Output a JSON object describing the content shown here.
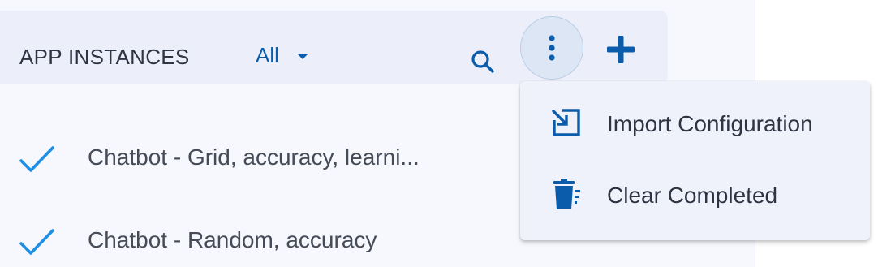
{
  "header": {
    "title": "APP INSTANCES",
    "filter_value": "All",
    "icons": {
      "search": "search-icon",
      "more": "more-vert-icon",
      "add": "add-icon"
    }
  },
  "instances": [
    {
      "label": "Chatbot - Grid, accuracy, learni...",
      "status": "completed",
      "icon": "check-icon"
    },
    {
      "label": "Chatbot - Random, accuracy",
      "status": "completed",
      "icon": "check-icon"
    }
  ],
  "menu": {
    "items": [
      {
        "label": "Import Configuration",
        "icon": "import-icon"
      },
      {
        "label": "Clear Completed",
        "icon": "trash-icon"
      }
    ]
  },
  "colors": {
    "accent": "#0b5cab",
    "check": "#1f8fe5",
    "text": "#2f3544",
    "pane_bg": "#f7f8fe",
    "header_bg": "#eceff9",
    "menu_bg": "#eff2fb"
  }
}
